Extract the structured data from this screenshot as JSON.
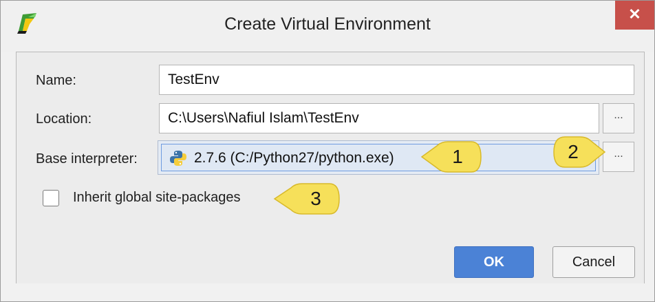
{
  "window": {
    "title": "Create Virtual Environment",
    "close_glyph": "✕"
  },
  "form": {
    "name_label": "Name:",
    "name_value": "TestEnv",
    "location_label": "Location:",
    "location_value": "C:\\Users\\Nafiul Islam\\TestEnv",
    "interpreter_label": "Base interpreter:",
    "interpreter_value": "2.7.6 (C:/Python27/python.exe)",
    "browse_glyph": "...",
    "inherit_label": "Inherit global site-packages",
    "inherit_checked": false
  },
  "buttons": {
    "ok": "OK",
    "cancel": "Cancel"
  },
  "callouts": [
    "1",
    "2",
    "3"
  ],
  "colors": {
    "accent": "#4b82d6",
    "close": "#c7504a",
    "callout": "#f6e05a"
  },
  "icons": {
    "app": "pycharm-icon",
    "interpreter": "python-icon"
  }
}
